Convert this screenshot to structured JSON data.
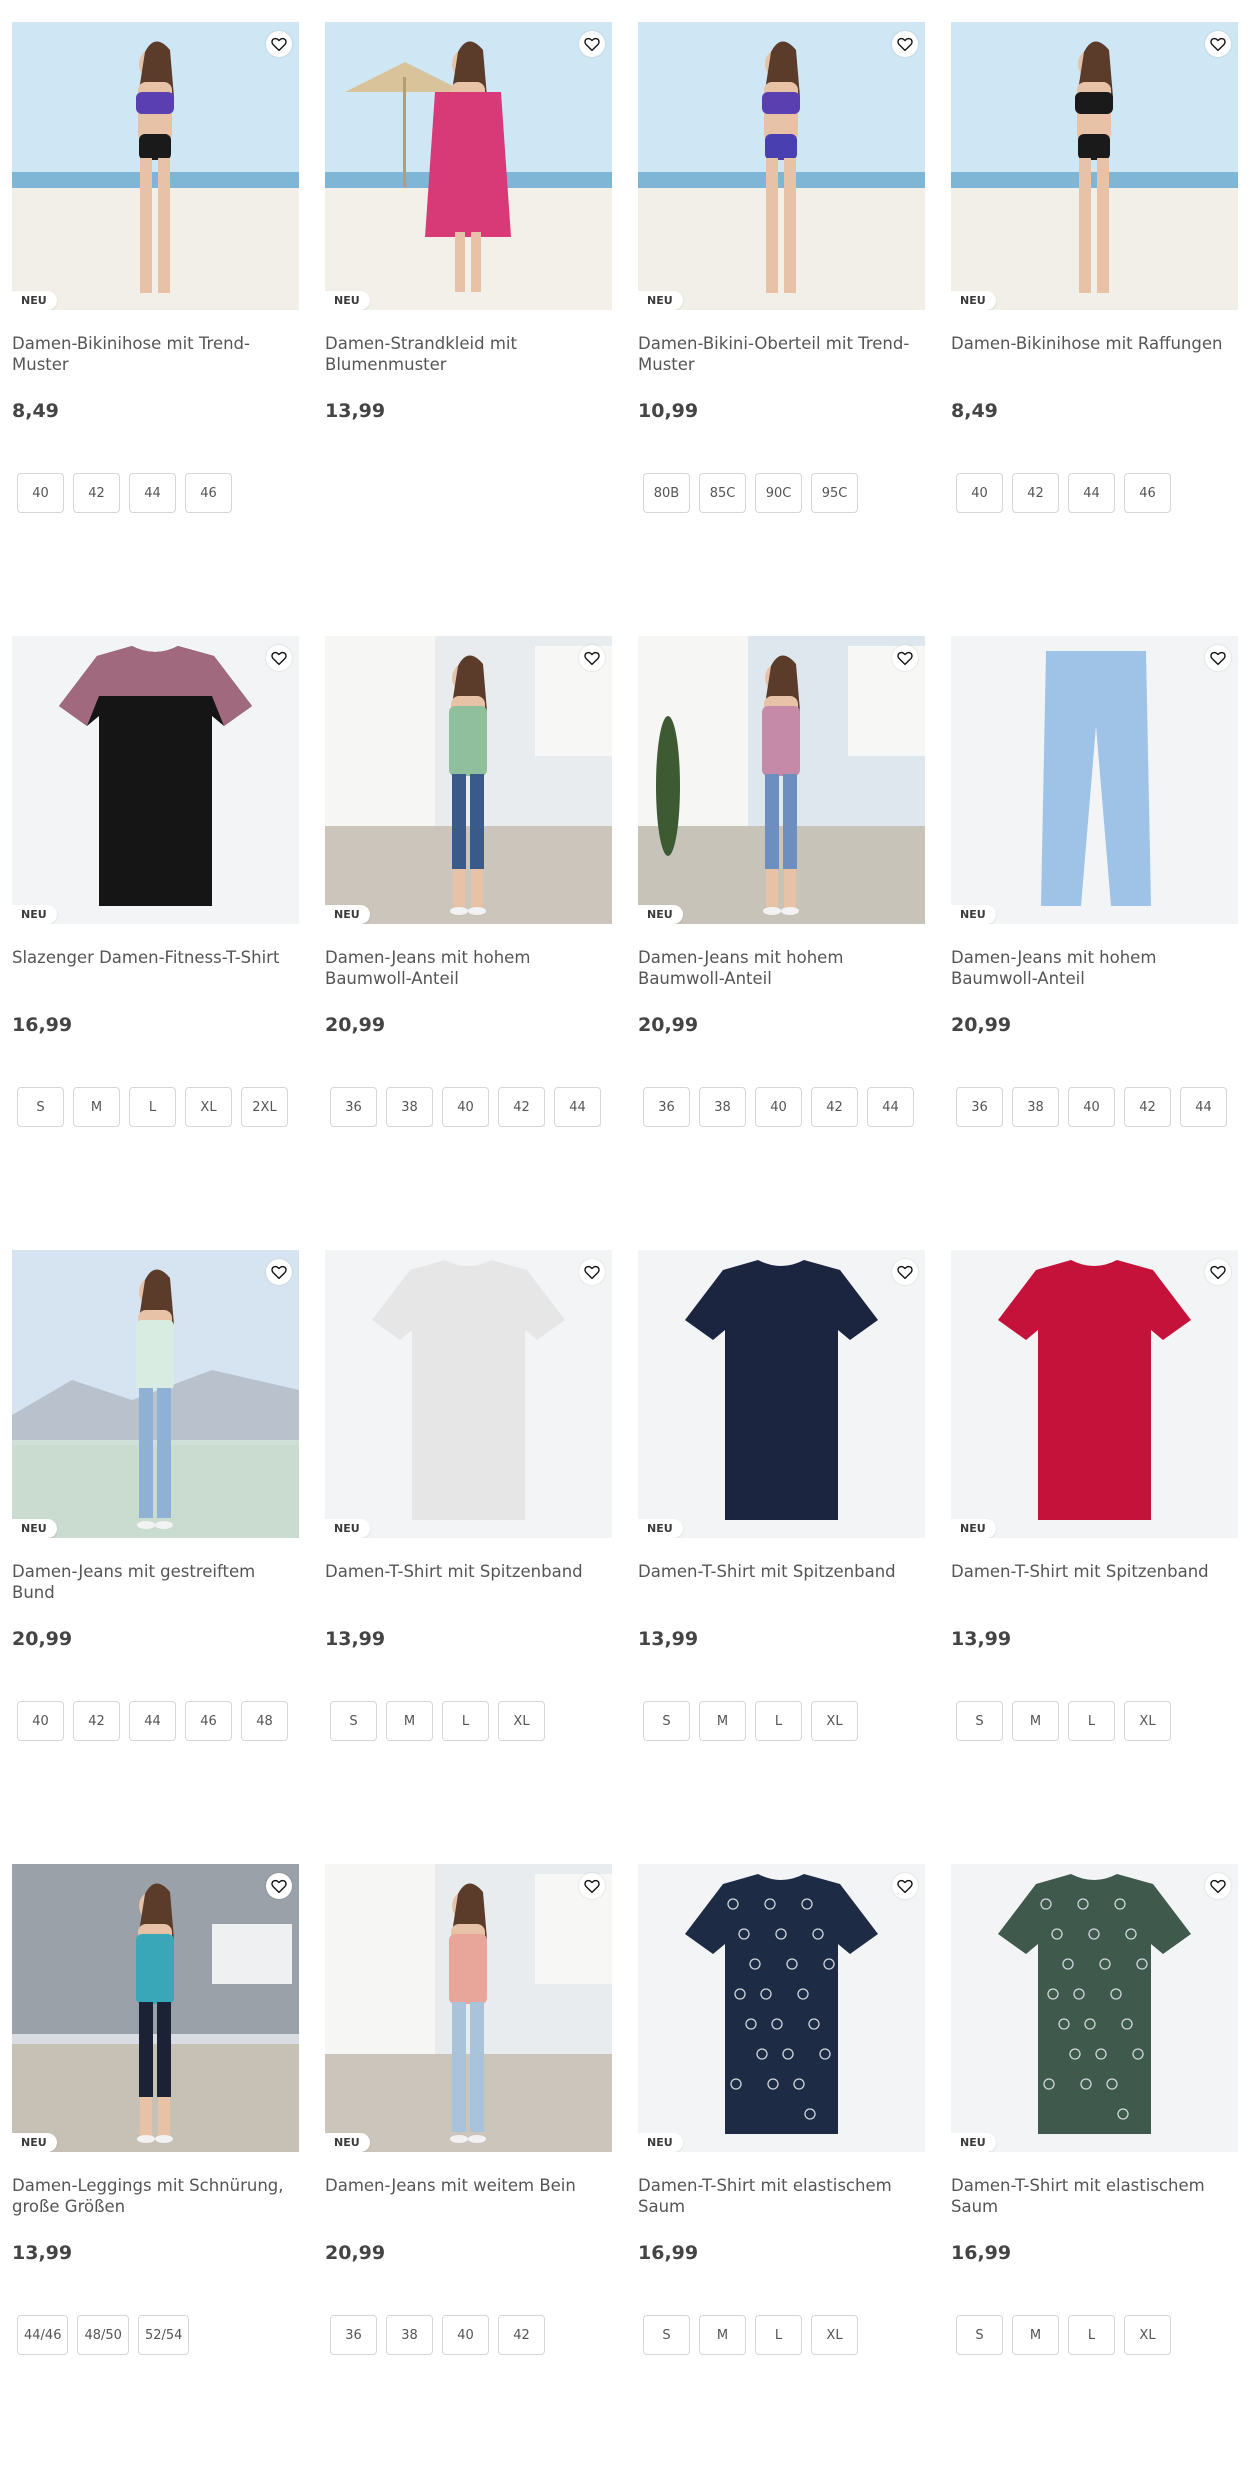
{
  "products": [
    {
      "title": "Damen-Bikinihose mit Trend-Muster",
      "price": "8,49",
      "badge": "NEU",
      "sizes": [
        "40",
        "42",
        "44",
        "46"
      ],
      "scene": "beach",
      "garment": "bikini-blue",
      "colors": {
        "top": "#5a3fb0",
        "bottom": "#1a1a1a"
      }
    },
    {
      "title": "Damen-Strandkleid mit Blumenmuster",
      "price": "13,99",
      "badge": "NEU",
      "sizes": [],
      "scene": "beach-umbrella",
      "garment": "dress",
      "colors": {
        "top": "#d83a78",
        "bottom": "#1c1c1c"
      }
    },
    {
      "title": "Damen-Bikini-Oberteil mit Trend-Muster",
      "price": "10,99",
      "badge": "NEU",
      "sizes": [
        "80B",
        "85C",
        "90C",
        "95C"
      ],
      "scene": "beach",
      "garment": "bikini-blue-close",
      "colors": {
        "top": "#5a3fb0",
        "bottom": "#4a3fb0"
      }
    },
    {
      "title": "Damen-Bikinihose mit Raffungen",
      "price": "8,49",
      "badge": "NEU",
      "sizes": [
        "40",
        "42",
        "44",
        "46"
      ],
      "scene": "beach",
      "garment": "bikini-black",
      "colors": {
        "top": "#1a1a1a",
        "bottom": "#1a1a1a"
      }
    },
    {
      "title": "Slazenger Damen-Fitness-T-Shirt",
      "price": "16,99",
      "badge": "NEU",
      "sizes": [
        "S",
        "M",
        "L",
        "XL",
        "2XL"
      ],
      "scene": "studio",
      "garment": "tshirt-black",
      "colors": {
        "top": "#151515",
        "bottom": "#c9869c"
      }
    },
    {
      "title": "Damen-Jeans mit hohem Baumwoll-Anteil",
      "price": "20,99",
      "badge": "NEU",
      "sizes": [
        "36",
        "38",
        "40",
        "42",
        "44"
      ],
      "scene": "villa",
      "garment": "capri-top",
      "colors": {
        "top": "#8fbf9c",
        "bottom": "#3a5a8a"
      }
    },
    {
      "title": "Damen-Jeans mit hohem Baumwoll-Anteil",
      "price": "20,99",
      "badge": "NEU",
      "sizes": [
        "36",
        "38",
        "40",
        "42",
        "44"
      ],
      "scene": "villa-cypress",
      "garment": "capri-stripes",
      "colors": {
        "top": "#c58aa8",
        "bottom": "#6d8fc0"
      }
    },
    {
      "title": "Damen-Jeans mit hohem Baumwoll-Anteil",
      "price": "20,99",
      "badge": "NEU",
      "sizes": [
        "36",
        "38",
        "40",
        "42",
        "44"
      ],
      "scene": "studio",
      "garment": "jeans-light",
      "colors": {
        "top": "#9ec3e6",
        "bottom": "#9ec3e6"
      }
    },
    {
      "title": "Damen-Jeans mit gestreiftem Bund",
      "price": "20,99",
      "badge": "NEU",
      "sizes": [
        "40",
        "42",
        "44",
        "46",
        "48"
      ],
      "scene": "promenade",
      "garment": "jeans-full",
      "colors": {
        "top": "#d8ece2",
        "bottom": "#8fb2d4"
      }
    },
    {
      "title": "Damen-T-Shirt mit Spitzenband",
      "price": "13,99",
      "badge": "NEU",
      "sizes": [
        "S",
        "M",
        "L",
        "XL"
      ],
      "scene": "studio",
      "garment": "tee-light",
      "colors": {
        "top": "#e6e6e6",
        "bottom": "#e6e6e6"
      }
    },
    {
      "title": "Damen-T-Shirt mit Spitzenband",
      "price": "13,99",
      "badge": "NEU",
      "sizes": [
        "S",
        "M",
        "L",
        "XL"
      ],
      "scene": "studio",
      "garment": "tee-navy",
      "colors": {
        "top": "#1c2540",
        "bottom": "#1c2540"
      }
    },
    {
      "title": "Damen-T-Shirt mit Spitzenband",
      "price": "13,99",
      "badge": "NEU",
      "sizes": [
        "S",
        "M",
        "L",
        "XL"
      ],
      "scene": "studio",
      "garment": "tee-red",
      "colors": {
        "top": "#c4123a",
        "bottom": "#c4123a"
      }
    },
    {
      "title": "Damen-Leggings mit Schnürung, große Größen",
      "price": "13,99",
      "badge": "NEU",
      "sizes": [
        "44/46",
        "48/50",
        "52/54"
      ],
      "scene": "porch",
      "garment": "leggings",
      "colors": {
        "top": "#3aa7b8",
        "bottom": "#1b2236"
      }
    },
    {
      "title": "Damen-Jeans mit weitem Bein",
      "price": "20,99",
      "badge": "NEU",
      "sizes": [
        "36",
        "38",
        "40",
        "42"
      ],
      "scene": "villa",
      "garment": "wideleg",
      "colors": {
        "top": "#e8a59a",
        "bottom": "#a9c3da"
      }
    },
    {
      "title": "Damen-T-Shirt mit elastischem Saum",
      "price": "16,99",
      "badge": "NEU",
      "sizes": [
        "S",
        "M",
        "L",
        "XL"
      ],
      "scene": "studio",
      "garment": "tee-navy-print",
      "colors": {
        "top": "#1d2b45",
        "bottom": "#1d2b45"
      }
    },
    {
      "title": "Damen-T-Shirt mit elastischem Saum",
      "price": "16,99",
      "badge": "NEU",
      "sizes": [
        "S",
        "M",
        "L",
        "XL"
      ],
      "scene": "studio",
      "garment": "tee-green-print",
      "colors": {
        "top": "#3f5a4d",
        "bottom": "#3f5a4d"
      }
    }
  ],
  "icons": {
    "favorite": "heart-outline-icon"
  }
}
